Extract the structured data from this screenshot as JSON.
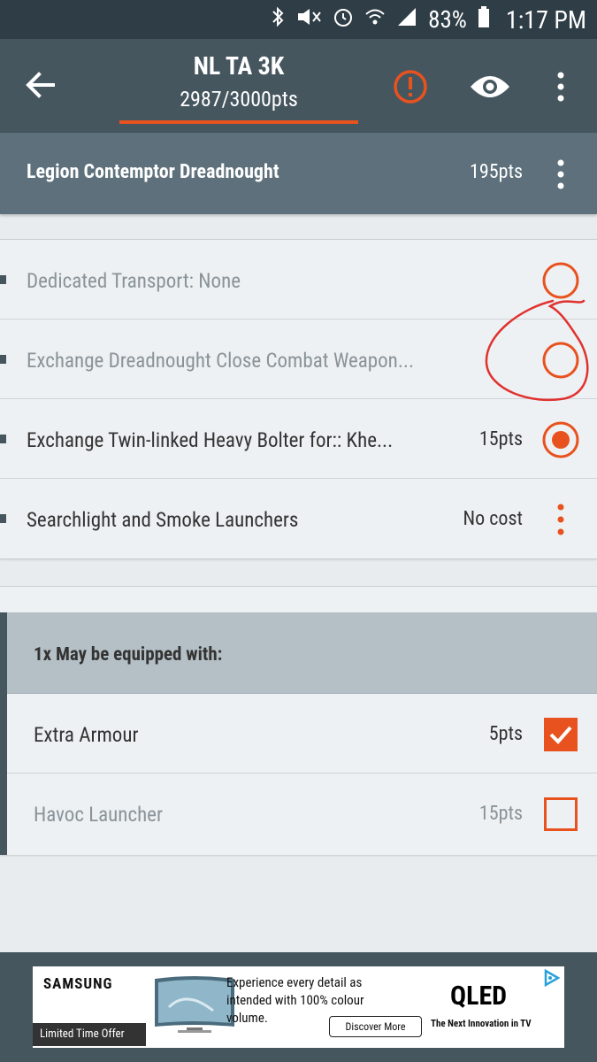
{
  "status_bar": {
    "battery": "83%",
    "time": "1:17 PM",
    "icons": [
      "bluetooth-icon",
      "mute-icon",
      "alarm-icon",
      "wifi-icon",
      "signal-icon",
      "battery-icon"
    ]
  },
  "app_bar": {
    "title": "NL TA 3K",
    "points": "2987/3000pts",
    "icons": [
      "back-arrow-icon",
      "warning-icon",
      "eye-icon",
      "more-vert-icon"
    ]
  },
  "unit": {
    "name": "Legion Contemptor Dreadnought",
    "points": "195pts"
  },
  "options": [
    {
      "label": "Dedicated Transport: None",
      "cost": "",
      "control": "radio",
      "selected": false,
      "muted": true
    },
    {
      "label": "Exchange Dreadnought Close Combat Weapon...",
      "cost": "",
      "control": "radio",
      "selected": false,
      "muted": true
    },
    {
      "label": "Exchange Twin-linked Heavy Bolter for:: Khe...",
      "cost": "15pts",
      "control": "radio",
      "selected": true,
      "muted": false
    },
    {
      "label": "Searchlight and Smoke Launchers",
      "cost": "No cost",
      "control": "more",
      "selected": false,
      "muted": false
    }
  ],
  "group": {
    "header": "1x May be equipped with:",
    "items": [
      {
        "label": "Extra Armour",
        "cost": "5pts",
        "checked": true,
        "muted": false
      },
      {
        "label": "Havoc Launcher",
        "cost": "15pts",
        "checked": false,
        "muted": true
      }
    ]
  },
  "ad": {
    "brand": "SAMSUNG",
    "offer": "Limited Time Offer",
    "copy": "Experience every detail as intended with 100% colour volume.",
    "cta": "Discover More",
    "product": "QLED",
    "tagline": "The Next Innovation in TV"
  },
  "colors": {
    "accent": "#e8521f",
    "app_bar": "#46565f",
    "status_bar": "#2f3d46",
    "unit_header": "#5d707b",
    "group_header": "#b5c0c6",
    "annotation": "#e0322f"
  }
}
